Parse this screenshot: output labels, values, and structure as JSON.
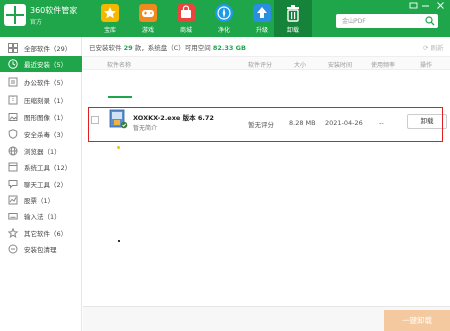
{
  "app": {
    "title": "360软件管家",
    "version": "官方"
  },
  "nav": [
    {
      "id": "store",
      "label": "宝库",
      "icon": "star-icon"
    },
    {
      "id": "games",
      "label": "游戏",
      "icon": "gamepad-icon"
    },
    {
      "id": "shop",
      "label": "商城",
      "icon": "shop-bag-icon"
    },
    {
      "id": "clean",
      "label": "净化",
      "icon": "compass-icon"
    },
    {
      "id": "upgrade",
      "label": "升级",
      "icon": "upgrade-arrow-icon"
    },
    {
      "id": "uninstall",
      "label": "卸载",
      "icon": "trash-icon"
    }
  ],
  "search": {
    "placeholder": "金山PDF"
  },
  "sidebar": {
    "items": [
      {
        "label": "全部软件（29）",
        "icon": "grid-icon",
        "active": false
      },
      {
        "label": "最近安装（5）",
        "icon": "clock-icon",
        "active": true
      },
      {
        "label": "办公软件（5）",
        "icon": "office-icon",
        "active": false
      },
      {
        "label": "压缩刻录（1）",
        "icon": "archive-icon",
        "active": false
      },
      {
        "label": "图形图像（1）",
        "icon": "image-icon",
        "active": false
      },
      {
        "label": "安全杀毒（3）",
        "icon": "shield-icon",
        "active": false
      },
      {
        "label": "浏览器（1）",
        "icon": "browser-icon",
        "active": false
      },
      {
        "label": "系统工具（12）",
        "icon": "tools-icon",
        "active": false
      },
      {
        "label": "聊天工具（2）",
        "icon": "chat-icon",
        "active": false
      },
      {
        "label": "股票（1）",
        "icon": "stock-icon",
        "active": false
      },
      {
        "label": "输入法（1）",
        "icon": "keyboard-icon",
        "active": false
      },
      {
        "label": "其它软件（6）",
        "icon": "star-outline-icon",
        "active": false
      },
      {
        "label": "安装包清理",
        "icon": "package-clean-icon",
        "active": false
      }
    ]
  },
  "main": {
    "info_prefix": "已安装软件",
    "info_count": "29",
    "info_suffix": "款，系统盘（C）可用空间",
    "info_space": "82.33 GB",
    "refresh_label": "刷新",
    "columns": [
      "软件名称",
      "软件评分",
      "大小",
      "安装时间",
      "使用频率",
      "操作"
    ],
    "rows": [
      {
        "name": "XOXKX-2.exe 版本 6.72",
        "desc": "暂无简介",
        "score": "暂无评分",
        "size": "8.28 MB",
        "date": "2021-04-26",
        "freq": "--",
        "action": "卸载"
      }
    ]
  },
  "footer": {
    "onekey_label": "一键卸载"
  },
  "colors": {
    "brand": "#1fa64a",
    "highlight": "#e02020"
  }
}
